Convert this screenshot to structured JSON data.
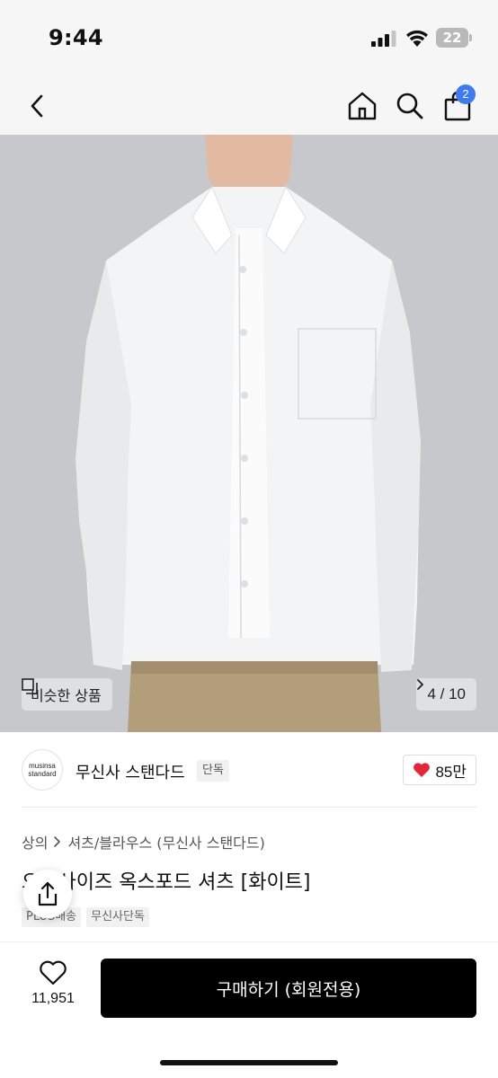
{
  "status_bar": {
    "time": "9:44",
    "battery": "22"
  },
  "nav": {
    "back_icon": "chevron-left-icon",
    "home_icon": "home-icon",
    "search_icon": "search-icon",
    "cart_icon": "bag-icon",
    "cart_count": "2",
    "accent": "#3d7bf5"
  },
  "gallery": {
    "similar_label": "비슷한 상품",
    "page_indicator": "4 / 10"
  },
  "brand": {
    "logo_line1": "musinsa",
    "logo_line2": "standard",
    "name": "무신사 스탠다드",
    "tag": "단독",
    "likes": "85만",
    "heart_color": "#e8243b"
  },
  "product": {
    "breadcrumb": [
      "상의",
      "셔츠/블라우스 (무신사 스탠다드)"
    ],
    "title": "오버사이즈 옥스포드 셔츠 [화이트]",
    "tags": [
      "PLUS배송",
      "무신사단독"
    ]
  },
  "bottom_bar": {
    "wish_count": "11,951",
    "buy_label": "구매하기 (회원전용)"
  }
}
